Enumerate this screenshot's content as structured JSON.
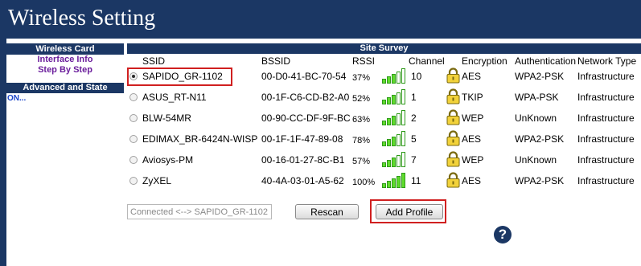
{
  "window": {
    "title": "Wireless Setting"
  },
  "sidebar": {
    "section1_title": "Wireless Card",
    "links": [
      "Interface Info",
      "Step By Step"
    ],
    "section2_title": "Advanced and State",
    "state": "ON..."
  },
  "survey": {
    "title": "Site Survey",
    "columns": [
      "SSID",
      "BSSID",
      "RSSI",
      "Channel",
      "Encryption",
      "Authentication",
      "Network Type"
    ],
    "rows": [
      {
        "selected": true,
        "ssid": "SAPIDO_GR-1102",
        "bssid": "00-D0-41-BC-70-54",
        "rssi": "37%",
        "signal_bars": 3,
        "channel": "10",
        "encryption": "AES",
        "authentication": "WPA2-PSK",
        "network_type": "Infrastructure"
      },
      {
        "selected": false,
        "ssid": "ASUS_RT-N11",
        "bssid": "00-1F-C6-CD-B2-A0",
        "rssi": "52%",
        "signal_bars": 3,
        "channel": "1",
        "encryption": "TKIP",
        "authentication": "WPA-PSK",
        "network_type": "Infrastructure"
      },
      {
        "selected": false,
        "ssid": "BLW-54MR",
        "bssid": "00-90-CC-DF-9F-BC",
        "rssi": "63%",
        "signal_bars": 3,
        "channel": "2",
        "encryption": "WEP",
        "authentication": "UnKnown",
        "network_type": "Infrastructure"
      },
      {
        "selected": false,
        "ssid": "EDIMAX_BR-6424N-WISP",
        "bssid": "00-1F-1F-47-89-08",
        "rssi": "78%",
        "signal_bars": 3,
        "channel": "5",
        "encryption": "AES",
        "authentication": "WPA2-PSK",
        "network_type": "Infrastructure"
      },
      {
        "selected": false,
        "ssid": "Aviosys-PM",
        "bssid": "00-16-01-27-8C-B1",
        "rssi": "57%",
        "signal_bars": 3,
        "channel": "7",
        "encryption": "WEP",
        "authentication": "UnKnown",
        "network_type": "Infrastructure"
      },
      {
        "selected": false,
        "ssid": "ZyXEL",
        "bssid": "40-4A-03-01-A5-62",
        "rssi": "100%",
        "signal_bars": 5,
        "channel": "11",
        "encryption": "AES",
        "authentication": "WPA2-PSK",
        "network_type": "Infrastructure"
      }
    ]
  },
  "bottom": {
    "status_value": "Connected <--> SAPIDO_GR-1102",
    "rescan_label": "Rescan",
    "add_profile_label": "Add Profile"
  },
  "help_label": "?",
  "colors": {
    "frame": "#1b3764",
    "link": "#6b1e9c",
    "signal": "#5fdb2c",
    "highlight": "#d02020"
  },
  "icons": {
    "row_status": "lock-icon",
    "signal": "signal-bars-icon",
    "help": "help-icon"
  }
}
